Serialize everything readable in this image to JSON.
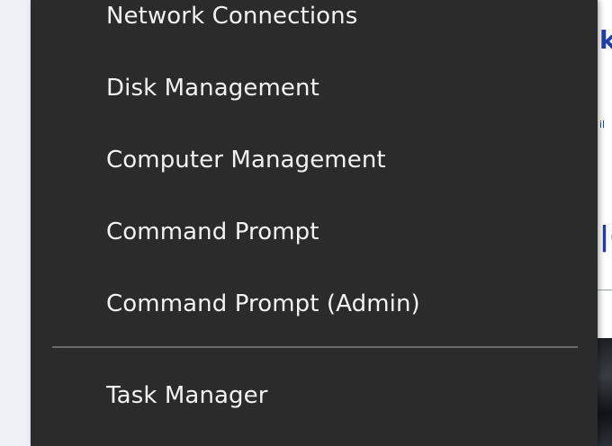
{
  "menu": {
    "items": [
      {
        "label": "Network Connections"
      },
      {
        "label": "Disk Management"
      },
      {
        "label": "Computer Management"
      },
      {
        "label": "Command Prompt"
      },
      {
        "label": "Command Prompt (Admin)"
      },
      {
        "label": "Task Manager"
      }
    ]
  },
  "background_window": {
    "peek_texts": [
      "k",
      "il",
      "|("
    ]
  },
  "colors": {
    "menu_background": "#2b2b2b",
    "menu_text": "#f2f2f2",
    "separator": "#6a6a6a"
  }
}
